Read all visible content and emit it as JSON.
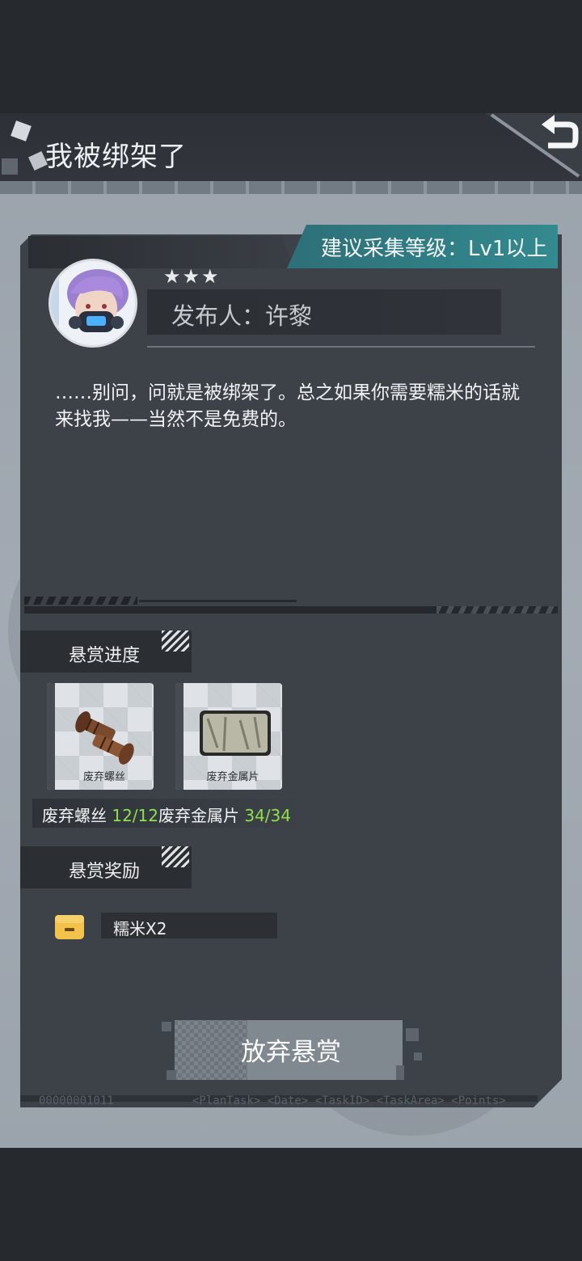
{
  "header": {
    "title": "我被绑架了",
    "back_icon": "back-arrow-icon"
  },
  "bounty": {
    "recommended_level": "建议采集等级：Lv1以上",
    "stars": "★★★",
    "star_rating": 3,
    "publisher": "发布人：许黎",
    "description": "……别问，问就是被绑架了。总之如果你需要糯米的话就来找我——当然不是免费的。"
  },
  "progress_section": {
    "title": "悬赏进度",
    "items": [
      {
        "label": "废弃螺丝",
        "icon": "screw-icon"
      },
      {
        "label": "废弃金属片",
        "icon": "metal-sheet-icon"
      }
    ],
    "counts": [
      {
        "name": "废弃螺丝",
        "count": "12/12"
      },
      {
        "name": "废弃金属片",
        "count": "34/34"
      }
    ]
  },
  "reward_section": {
    "title": "悬赏奖励",
    "reward_label": "糯米X2",
    "reward_icon": "reward-box-icon"
  },
  "actions": {
    "abandon_label": "放弃悬赏"
  },
  "footer": {
    "code": "00000001011",
    "meta": "<PlanTask> <Date> <TaskID> <TaskArea> <Points>"
  },
  "colors": {
    "accent_teal": "#338a8f",
    "progress_green": "#8fe04b",
    "reward_yellow": "#f2c24a"
  }
}
